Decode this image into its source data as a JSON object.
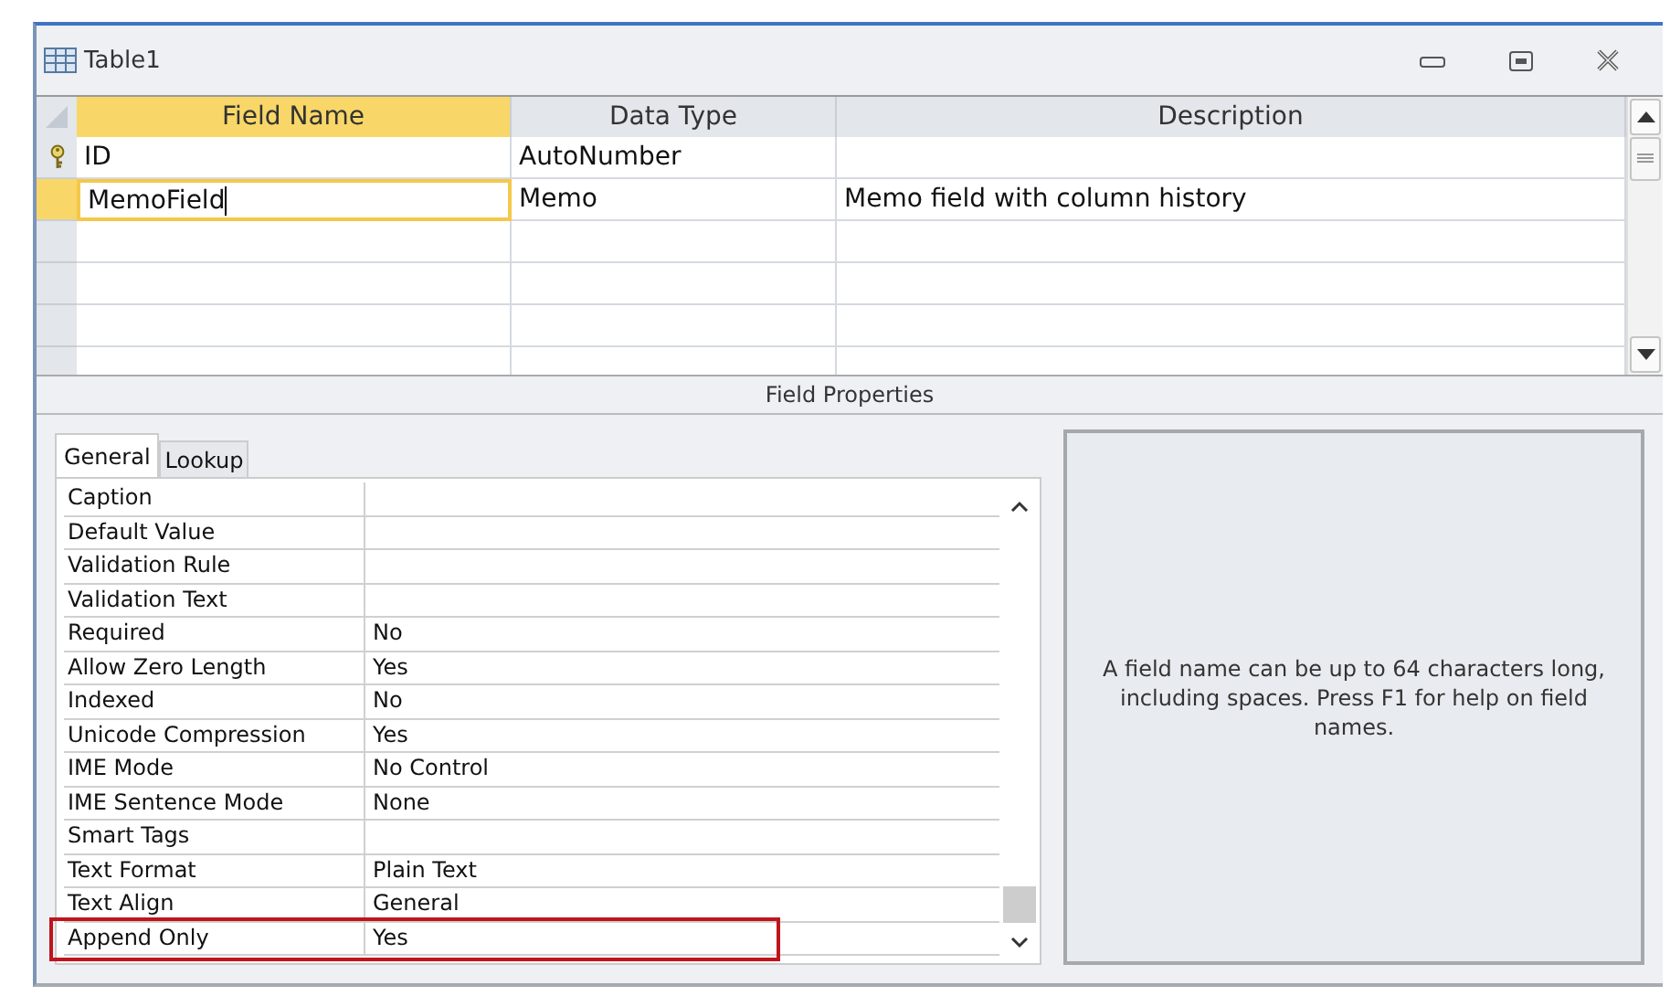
{
  "window": {
    "title": "Table1"
  },
  "grid": {
    "columns": [
      "Field Name",
      "Data Type",
      "Description"
    ],
    "rows": [
      {
        "field_name": "ID",
        "data_type": "AutoNumber",
        "primary_key": true,
        "selected": false
      },
      {
        "field_name": "MemoField",
        "data_type": "Memo",
        "description": "Memo field with column history",
        "primary_key": false,
        "selected": true
      }
    ]
  },
  "field_properties": {
    "title": "Field Properties",
    "tabs": [
      {
        "label": "General",
        "selected": true
      },
      {
        "label": "Lookup",
        "selected": false
      }
    ],
    "properties": [
      {
        "name": "Caption",
        "highlighted": false
      },
      {
        "name": "Default Value",
        "highlighted": false
      },
      {
        "name": "Validation Rule",
        "highlighted": false
      },
      {
        "name": "Validation Text",
        "highlighted": false
      },
      {
        "name": "Required",
        "value": "No",
        "highlighted": false
      },
      {
        "name": "Allow Zero Length",
        "value": "Yes",
        "highlighted": false
      },
      {
        "name": "Indexed",
        "value": "No",
        "highlighted": false
      },
      {
        "name": "Unicode Compression",
        "value": "Yes",
        "highlighted": false
      },
      {
        "name": "IME Mode",
        "value": "No Control",
        "highlighted": false
      },
      {
        "name": "IME Sentence Mode",
        "value": "None",
        "highlighted": false
      },
      {
        "name": "Smart Tags",
        "highlighted": false
      },
      {
        "name": "Text Format",
        "value": "Plain Text",
        "highlighted": false
      },
      {
        "name": "Text Align",
        "value": "General",
        "highlighted": false
      },
      {
        "name": "Append Only",
        "value": "Yes",
        "highlighted": true
      }
    ],
    "help_text": "A field name can be up to 64 characters long, including spaces. Press F1 for help on field names."
  }
}
